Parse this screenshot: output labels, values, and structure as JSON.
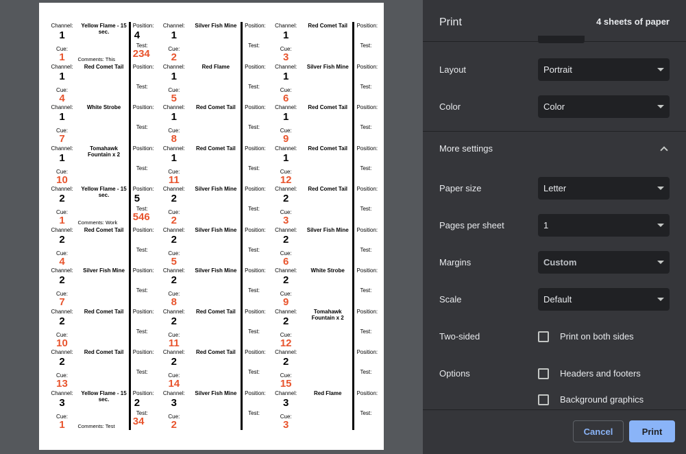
{
  "panel": {
    "title": "Print",
    "sheets": "4 sheets of paper",
    "layout": {
      "label": "Layout",
      "value": "Portrait"
    },
    "color": {
      "label": "Color",
      "value": "Color"
    },
    "more_settings": "More settings",
    "paper_size": {
      "label": "Paper size",
      "value": "Letter"
    },
    "pages_per_sheet": {
      "label": "Pages per sheet",
      "value": "1"
    },
    "margins": {
      "label": "Margins",
      "value": "Custom"
    },
    "scale": {
      "label": "Scale",
      "value": "Default"
    },
    "two_sided": {
      "label": "Two-sided",
      "option": "Print on both sides"
    },
    "options": {
      "label": "Options",
      "headers_footers": "Headers and footers",
      "background_graphics": "Background graphics"
    },
    "cancel": "Cancel",
    "print": "Print"
  },
  "preview": {
    "labels": {
      "channel": "Channel:",
      "cue": "Cue:",
      "position": "Position:",
      "test": "Test:"
    },
    "rows": [
      [
        {
          "channel": "1",
          "cue": "1",
          "name": "Yellow Flame - 15 sec.",
          "position": "4",
          "test": "234",
          "comments": "Comments: This"
        },
        {
          "channel": "1",
          "cue": "2",
          "name": "Silver Fish Mine",
          "position": "",
          "test": "",
          "comments": ""
        },
        {
          "channel": "1",
          "cue": "3",
          "name": "Red Comet Tail",
          "position": "",
          "test": "",
          "comments": ""
        }
      ],
      [
        {
          "channel": "1",
          "cue": "4",
          "name": "Red Comet Tail",
          "position": "",
          "test": "",
          "comments": ""
        },
        {
          "channel": "1",
          "cue": "5",
          "name": "Red Flame",
          "position": "",
          "test": "",
          "comments": ""
        },
        {
          "channel": "1",
          "cue": "6",
          "name": "Silver Fish Mine",
          "position": "",
          "test": "",
          "comments": ""
        }
      ],
      [
        {
          "channel": "1",
          "cue": "7",
          "name": "White Strobe",
          "position": "",
          "test": "",
          "comments": ""
        },
        {
          "channel": "1",
          "cue": "8",
          "name": "Red Comet Tail",
          "position": "",
          "test": "",
          "comments": ""
        },
        {
          "channel": "1",
          "cue": "9",
          "name": "Red Comet Tail",
          "position": "",
          "test": "",
          "comments": ""
        }
      ],
      [
        {
          "channel": "1",
          "cue": "10",
          "name": "Tomahawk Fountain x 2",
          "position": "",
          "test": "",
          "comments": ""
        },
        {
          "channel": "1",
          "cue": "11",
          "name": "Red Comet Tail",
          "position": "",
          "test": "",
          "comments": ""
        },
        {
          "channel": "1",
          "cue": "12",
          "name": "Red Comet Tail",
          "position": "",
          "test": "",
          "comments": ""
        }
      ],
      [
        {
          "channel": "2",
          "cue": "1",
          "name": "Yellow Flame - 15 sec.",
          "position": "5",
          "test": "546",
          "comments": "Comments: Work"
        },
        {
          "channel": "2",
          "cue": "2",
          "name": "Silver Fish Mine",
          "position": "",
          "test": "",
          "comments": ""
        },
        {
          "channel": "2",
          "cue": "3",
          "name": "Red Comet Tail",
          "position": "",
          "test": "",
          "comments": ""
        }
      ],
      [
        {
          "channel": "2",
          "cue": "4",
          "name": "Red Comet Tail",
          "position": "",
          "test": "",
          "comments": ""
        },
        {
          "channel": "2",
          "cue": "5",
          "name": "Silver Fish Mine",
          "position": "",
          "test": "",
          "comments": ""
        },
        {
          "channel": "2",
          "cue": "6",
          "name": "Silver Fish Mine",
          "position": "",
          "test": "",
          "comments": ""
        }
      ],
      [
        {
          "channel": "2",
          "cue": "7",
          "name": "Silver Fish Mine",
          "position": "",
          "test": "",
          "comments": ""
        },
        {
          "channel": "2",
          "cue": "8",
          "name": "Silver Fish Mine",
          "position": "",
          "test": "",
          "comments": ""
        },
        {
          "channel": "2",
          "cue": "9",
          "name": "White Strobe",
          "position": "",
          "test": "",
          "comments": ""
        }
      ],
      [
        {
          "channel": "2",
          "cue": "10",
          "name": "Red Comet Tail",
          "position": "",
          "test": "",
          "comments": ""
        },
        {
          "channel": "2",
          "cue": "11",
          "name": "Red Comet Tail",
          "position": "",
          "test": "",
          "comments": ""
        },
        {
          "channel": "2",
          "cue": "12",
          "name": "Tomahawk Fountain x 2",
          "position": "",
          "test": "",
          "comments": ""
        }
      ],
      [
        {
          "channel": "2",
          "cue": "13",
          "name": "Red Comet Tail",
          "position": "",
          "test": "",
          "comments": ""
        },
        {
          "channel": "2",
          "cue": "14",
          "name": "Red Comet Tail",
          "position": "",
          "test": "",
          "comments": ""
        },
        {
          "channel": "2",
          "cue": "15",
          "name": "",
          "position": "",
          "test": "",
          "comments": ""
        }
      ],
      [
        {
          "channel": "3",
          "cue": "1",
          "name": "Yellow Flame - 15 sec.",
          "position": "2",
          "test": "34",
          "comments": "Comments: Test"
        },
        {
          "channel": "3",
          "cue": "2",
          "name": "Silver Fish Mine",
          "position": "",
          "test": "",
          "comments": ""
        },
        {
          "channel": "3",
          "cue": "3",
          "name": "Red Flame",
          "position": "",
          "test": "",
          "comments": ""
        }
      ]
    ]
  }
}
